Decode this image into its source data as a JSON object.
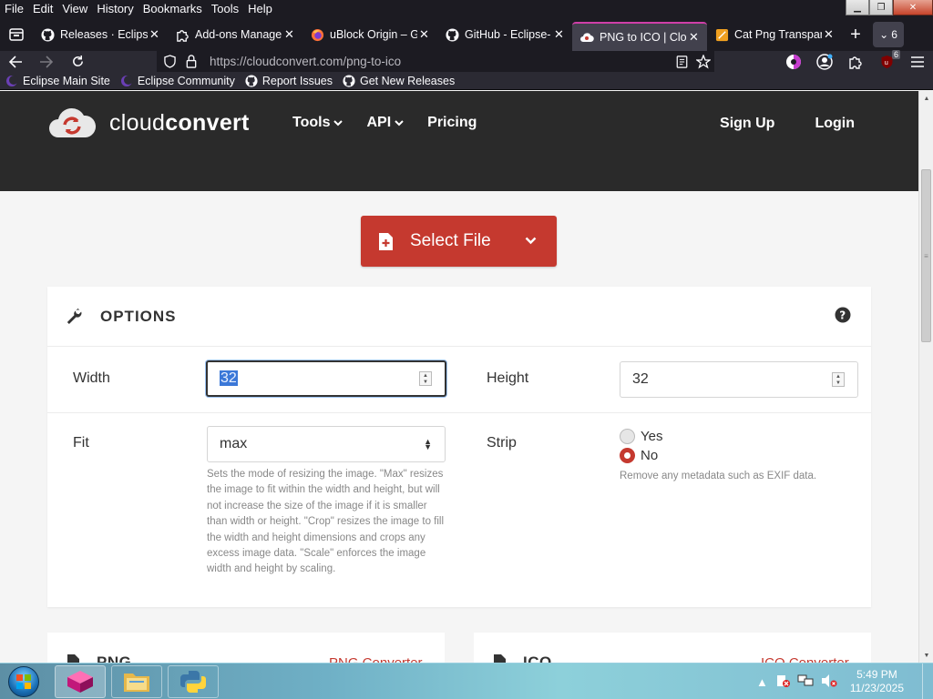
{
  "menubar": {
    "items": [
      "File",
      "Edit",
      "View",
      "History",
      "Bookmarks",
      "Tools",
      "Help"
    ]
  },
  "tabs": [
    {
      "title": "Releases · Eclipse",
      "icon": "github-icon",
      "active": false
    },
    {
      "title": "Add-ons Manager",
      "icon": "puzzle-icon",
      "active": false
    },
    {
      "title": "uBlock Origin – G",
      "icon": "firefox-icon",
      "active": false
    },
    {
      "title": "GitHub - Eclipse-",
      "icon": "github-icon",
      "active": false
    },
    {
      "title": "PNG to ICO | Clou",
      "icon": "cloudconvert-icon",
      "active": true
    },
    {
      "title": "Cat Png Transpar",
      "icon": "image-icon",
      "active": false
    }
  ],
  "tab_count": "6",
  "navbar": {
    "url": "https://cloudconvert.com/png-to-ico",
    "extension_badge": "6"
  },
  "bookmarks": [
    {
      "label": "Eclipse Main Site",
      "icon": "eclipse-icon"
    },
    {
      "label": "Eclipse Community",
      "icon": "eclipse-icon"
    },
    {
      "label": "Report Issues",
      "icon": "github-icon"
    },
    {
      "label": "Get New Releases",
      "icon": "github-icon"
    }
  ],
  "site": {
    "logo_light": "cloud",
    "logo_bold": "convert",
    "nav": [
      {
        "label": "Tools",
        "has_dropdown": true
      },
      {
        "label": "API",
        "has_dropdown": true
      },
      {
        "label": "Pricing",
        "has_dropdown": false
      }
    ],
    "sign_up": "Sign Up",
    "login": "Login",
    "select_file": "Select File"
  },
  "options": {
    "title": "OPTIONS",
    "width_label": "Width",
    "width_value": "32",
    "height_label": "Height",
    "height_value": "32",
    "fit_label": "Fit",
    "fit_value": "max",
    "fit_help": "Sets the mode of resizing the image. \"Max\" resizes the image to fit within the width and height, but will not increase the size of the image if it is smaller than width or height. \"Crop\" resizes the image to fill the width and height dimensions and crops any excess image data. \"Scale\" enforces the image width and height by scaling.",
    "strip_label": "Strip",
    "strip_yes": "Yes",
    "strip_no": "No",
    "strip_selected": "No",
    "strip_help": "Remove any metadata such as EXIF data."
  },
  "converters": [
    {
      "title": "PNG",
      "link": "PNG Converter"
    },
    {
      "title": "ICO",
      "link": "ICO Converter"
    }
  ],
  "taskbar": {
    "time": "5:49 PM",
    "date": "11/23/2025"
  },
  "colors": {
    "accent_red": "#c5392f",
    "hero_dark": "#2a2a2a",
    "tab_highlight": "#cf3fa8"
  }
}
